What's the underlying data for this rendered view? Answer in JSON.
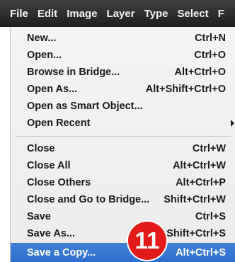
{
  "menubar": {
    "items": [
      "File",
      "Edit",
      "Image",
      "Layer",
      "Type",
      "Select",
      "F"
    ]
  },
  "file_menu": {
    "items": [
      {
        "label": "New...",
        "shortcut": "Ctrl+N"
      },
      {
        "label": "Open...",
        "shortcut": "Ctrl+O"
      },
      {
        "label": "Browse in Bridge...",
        "shortcut": "Alt+Ctrl+O"
      },
      {
        "label": "Open As...",
        "shortcut": "Alt+Shift+Ctrl+O"
      },
      {
        "label": "Open as Smart Object...",
        "shortcut": ""
      },
      {
        "label": "Open Recent",
        "shortcut": ""
      },
      {
        "label": "Close",
        "shortcut": "Ctrl+W"
      },
      {
        "label": "Close All",
        "shortcut": "Alt+Ctrl+W"
      },
      {
        "label": "Close Others",
        "shortcut": "Alt+Ctrl+P"
      },
      {
        "label": "Close and Go to Bridge...",
        "shortcut": "Shift+Ctrl+W"
      },
      {
        "label": "Save",
        "shortcut": "Ctrl+S"
      },
      {
        "label": "Save As...",
        "shortcut": "Shift+Ctrl+S"
      },
      {
        "label": "Save a Copy...",
        "shortcut": "Alt+Ctrl+S"
      }
    ]
  },
  "step_badge": "11",
  "colors": {
    "menubar_bg": "#2b2b2b",
    "highlight": "#3a78d4",
    "badge": "#e21a1a"
  }
}
